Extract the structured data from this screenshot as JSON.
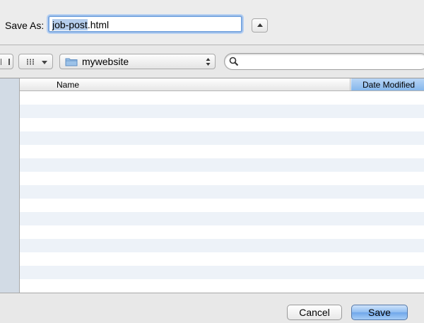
{
  "save_as": {
    "label": "Save As:",
    "filename_selected": "job-post",
    "filename_rest": ".html"
  },
  "toolbar": {
    "location": "mywebsite",
    "search_placeholder": ""
  },
  "file_list": {
    "columns": [
      "Name",
      "Date Modified"
    ],
    "rows": []
  },
  "buttons": {
    "cancel": "Cancel",
    "save": "Save"
  },
  "icons": {
    "expand": "disclosure-up-icon",
    "view": "column-view-icon",
    "arrange": "icon-grid-icon",
    "folder": "folder-icon",
    "search": "search-icon"
  },
  "colors": {
    "accent": "#85b7ec",
    "sidebar": "#d2dbe5",
    "row_alt": "#edf2f8"
  }
}
